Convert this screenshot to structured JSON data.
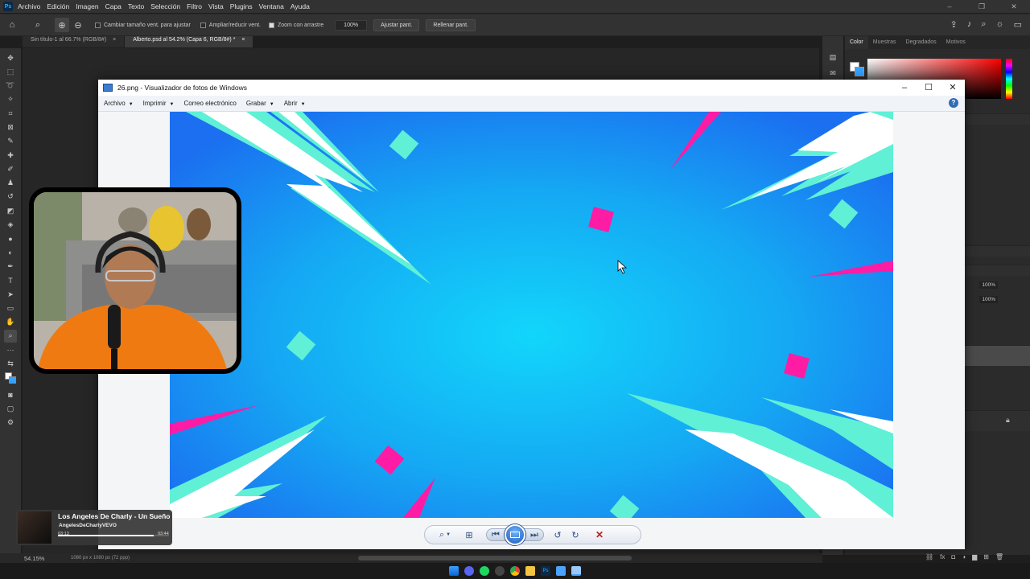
{
  "photoshop": {
    "menu": [
      "Archivo",
      "Edición",
      "Imagen",
      "Capa",
      "Texto",
      "Selección",
      "Filtro",
      "Vista",
      "Plugins",
      "Ventana",
      "Ayuda"
    ],
    "logo_text": "Ps",
    "options": {
      "resize_window": "Cambiar tamaño vent. para ajustar",
      "zoom_windows": "Ampliar/reducir vent.",
      "scrubby_zoom": "Zoom con arrastre",
      "zoom_value": "100%",
      "fit_screen": "Ajustar pant.",
      "fill_screen": "Rellenar pant."
    },
    "tabs": [
      "Sin título-1 al 66.7% (RGB/8#)",
      "Alberto.psd al 54.2% (Capa 6, RGB/8#) *"
    ],
    "tab_close": "×",
    "right_panel": {
      "tabs": [
        "Color",
        "Muestras",
        "Degradados",
        "Motivos"
      ],
      "opacity": "100%",
      "fill": "100%"
    },
    "status": {
      "zoom": "54.15%",
      "doc_info": "1080 px x 1080 px (72 ppp)"
    }
  },
  "viewer": {
    "title": "26.png - Visualizador de fotos de Windows",
    "menu": [
      "Archivo",
      "Imprimir",
      "Correo electrónico",
      "Grabar",
      "Abrir"
    ],
    "help": "?"
  },
  "now_playing": {
    "title": "Los Angeles De Charly - Un Sueño",
    "artist": "AngelesDeCharlyVEVO",
    "current_time": "03:13",
    "total_time": "03:44",
    "progress": 0.86
  },
  "icons": {
    "home": "home-icon",
    "zoom": "zoom-icon",
    "search": "search-icon",
    "share": "share-icon",
    "bell": "bell-icon"
  },
  "colors": {
    "ps_bg": "#323232",
    "photo_blue": "#1b8ff0",
    "accent_cyan": "#5ff0d6",
    "accent_magenta": "#ff1ca4"
  }
}
